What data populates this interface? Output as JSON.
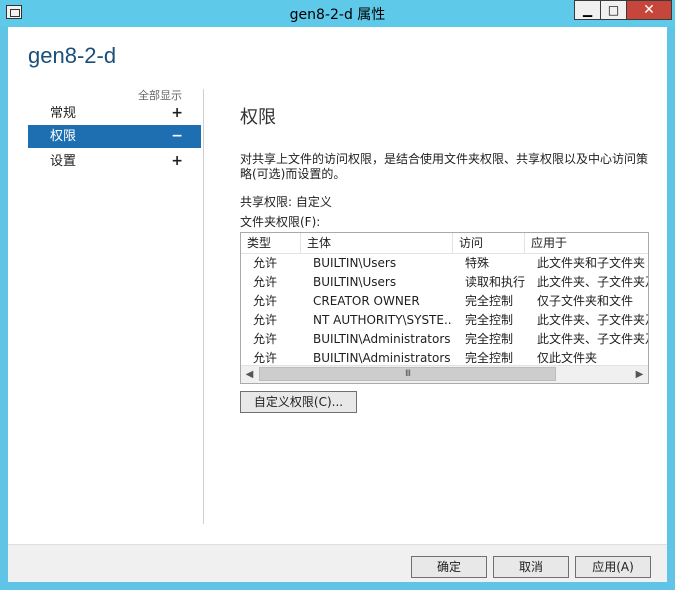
{
  "window": {
    "title": "gen8-2-d 属性",
    "min_label": "▁",
    "max_label": "□",
    "close_label": "✕"
  },
  "page": {
    "title": "gen8-2-d",
    "show_all": "全部显示"
  },
  "nav": [
    {
      "label": "常规",
      "sign": "+"
    },
    {
      "label": "权限",
      "sign": "−"
    },
    {
      "label": "设置",
      "sign": "+"
    }
  ],
  "section": {
    "title": "权限",
    "description": "对共享上文件的访问权限，是结合使用文件夹权限、共享权限以及中心访问策略(可选)而设置的。",
    "share_permission": "共享权限: 自定义",
    "folder_permission": "文件夹权限(F):"
  },
  "table": {
    "columns": [
      "类型",
      "主体",
      "访问",
      "应用于"
    ],
    "rows": [
      [
        "允许",
        "BUILTIN\\Users",
        "特殊",
        "此文件夹和子文件夹"
      ],
      [
        "允许",
        "BUILTIN\\Users",
        "读取和执行",
        "此文件夹、子文件夹及"
      ],
      [
        "允许",
        "CREATOR OWNER",
        "完全控制",
        "仅子文件夹和文件"
      ],
      [
        "允许",
        "NT AUTHORITY\\SYSTE...",
        "完全控制",
        "此文件夹、子文件夹及"
      ],
      [
        "允许",
        "BUILTIN\\Administrators",
        "完全控制",
        "此文件夹、子文件夹及"
      ],
      [
        "允许",
        "BUILTIN\\Administrators",
        "完全控制",
        "仅此文件夹"
      ]
    ],
    "scroll_left": "◀",
    "scroll_right": "▶",
    "scroll_thumb": "III"
  },
  "buttons": {
    "custom_permissions": "自定义权限(C)...",
    "ok": "确定",
    "cancel": "取消",
    "apply": "应用(A)"
  }
}
